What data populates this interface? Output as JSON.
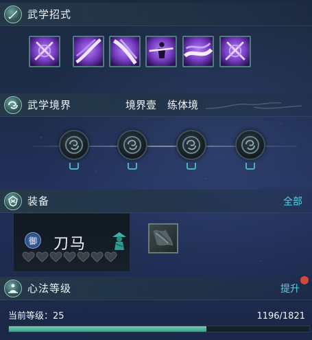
{
  "sections": {
    "skills": {
      "title": "武学招式",
      "icon": "sword-icon"
    },
    "realm": {
      "title": "武学境界",
      "realm_level": "境界壹",
      "realm_name": "练体境",
      "icon": "swirl-icon"
    },
    "equipment": {
      "title": "装备",
      "all_link": "全部",
      "icon": "shield-icon"
    },
    "mind": {
      "title": "心法等级",
      "upgrade_link": "提升",
      "icon": "meditation-icon"
    }
  },
  "skills": [
    {
      "icon": "crossed-blades-icon"
    },
    {
      "icon": "slash-icon"
    },
    {
      "icon": "sweep-icon"
    },
    {
      "icon": "warrior-strike-icon"
    },
    {
      "icon": "wave-slash-icon"
    },
    {
      "icon": "crossed-blades-icon"
    }
  ],
  "realm_nodes": [
    {
      "icon": "locked-swirl-icon"
    },
    {
      "icon": "locked-swirl-icon"
    },
    {
      "icon": "locked-swirl-icon"
    },
    {
      "icon": "locked-swirl-icon"
    }
  ],
  "equip": {
    "badge": "御",
    "name": "刀马",
    "hearts_total": 7,
    "hearts_filled": 0,
    "rider_icon": "hatted-rider-icon",
    "slot_icon": "cloth-armor-icon"
  },
  "level": {
    "label": "当前等级：25",
    "count": "1196/1821",
    "current": 1196,
    "max": 1821
  },
  "colors": {
    "accent_link": "#4fd6e6",
    "progress": "#5bb5a2",
    "notify": "#d5493a",
    "skill_purple": "#7a3fc4"
  }
}
